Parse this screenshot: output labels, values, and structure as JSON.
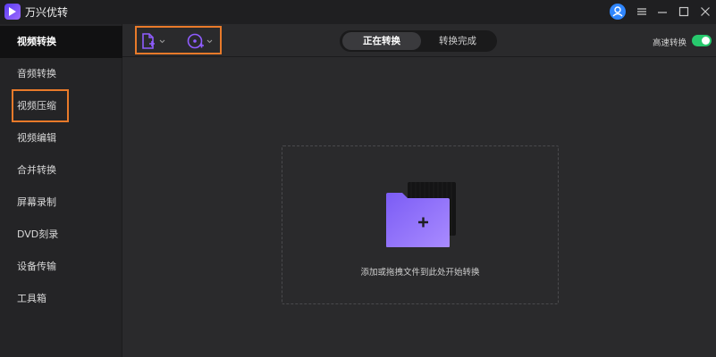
{
  "app": {
    "title": "万兴优转"
  },
  "sidebar": {
    "items": [
      {
        "label": "视频转换",
        "active": true
      },
      {
        "label": "音频转换"
      },
      {
        "label": "视频压缩"
      },
      {
        "label": "视频编辑"
      },
      {
        "label": "合并转换"
      },
      {
        "label": "屏幕录制"
      },
      {
        "label": "DVD刻录"
      },
      {
        "label": "设备传输"
      },
      {
        "label": "工具箱"
      }
    ]
  },
  "tabs": {
    "converting": "正在转换",
    "done": "转换完成"
  },
  "speed": {
    "label": "高速转换",
    "enabled": true
  },
  "dropzone": {
    "hint": "添加或拖拽文件到此处开始转换"
  },
  "colors": {
    "accent": "#8f5cff",
    "highlight": "#e87a2a",
    "toggle_on": "#27c96d",
    "user_avatar": "#2f86ff"
  },
  "icons": [
    "app-logo-icon",
    "user-icon",
    "menu-icon",
    "minimize-icon",
    "maximize-icon",
    "close-icon",
    "add-file-icon",
    "add-disc-icon",
    "chevron-down-icon",
    "folder-icon",
    "plus-icon"
  ]
}
